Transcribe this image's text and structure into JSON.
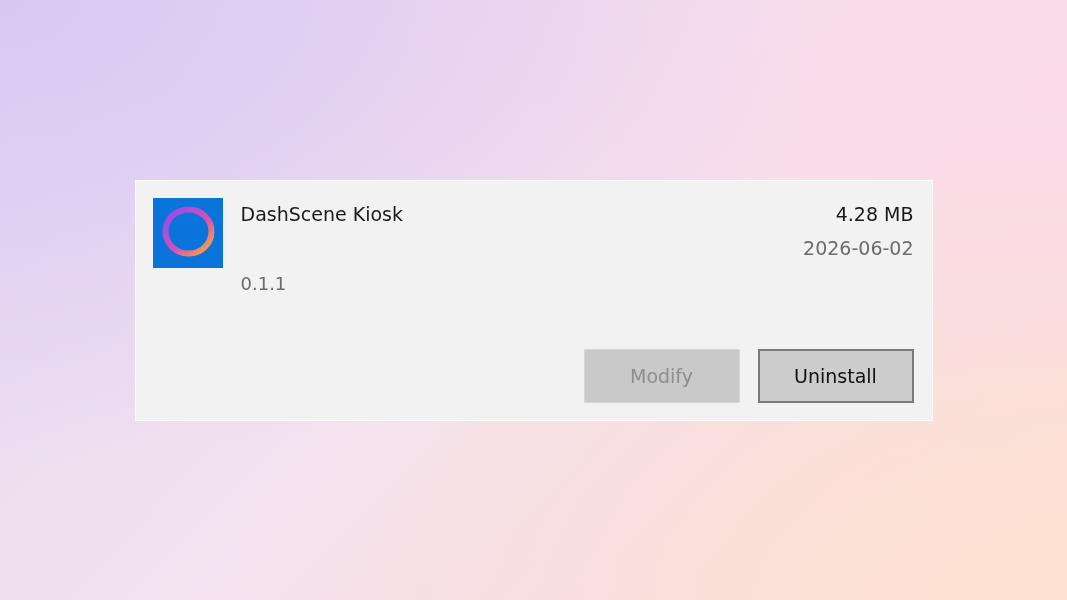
{
  "app": {
    "name": "DashScene Kiosk",
    "version": "0.1.1",
    "size": "4.28 MB",
    "install_date": "2026-06-02"
  },
  "buttons": [
    {
      "label": "Modify",
      "disabled": true,
      "focused": false
    },
    {
      "label": "Uninstall",
      "disabled": false,
      "focused": true
    }
  ]
}
